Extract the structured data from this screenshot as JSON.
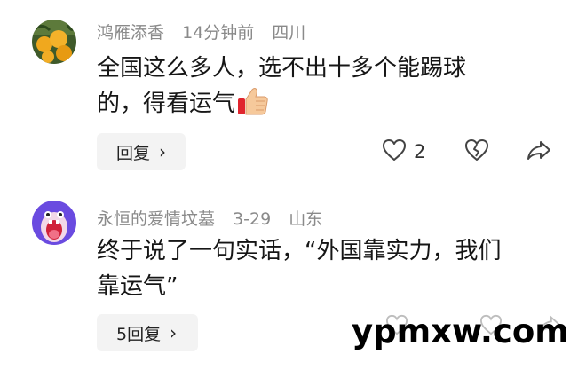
{
  "comments": [
    {
      "username": "鸿雁添香",
      "time": "14分钟前",
      "location": "四川",
      "text_line1": "全国这么多人，选不出十多个能踢球",
      "text_line2": "的，得看运气",
      "emoji": "thumbs-up-icon",
      "reply_label": "回复",
      "like_count": "2"
    },
    {
      "username": "永恒的爱情坟墓",
      "time": "3-29",
      "location": "山东",
      "text_line1": "终于说了一句实话，“外国靠实力，我们",
      "text_line2": "靠运气”",
      "reply_label": "5回复"
    }
  ],
  "watermark": "ypmxw.com",
  "colors": {
    "meta_text": "#8a8a8a",
    "reply_bg": "#f3f3f3",
    "avatar2_bg": "#6a4be0"
  }
}
